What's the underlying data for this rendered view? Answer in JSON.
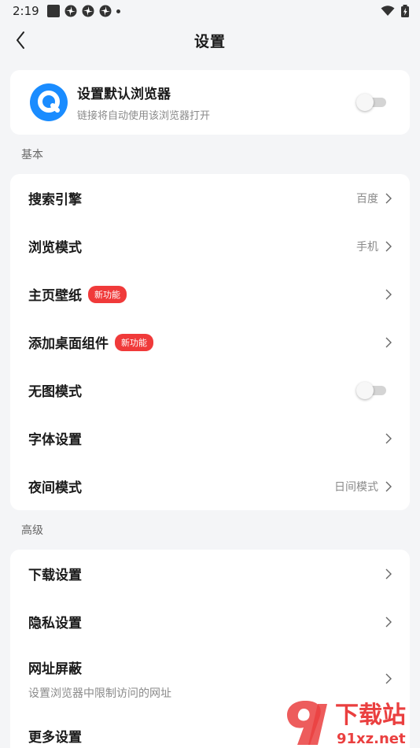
{
  "status": {
    "time": "2:19"
  },
  "header": {
    "title": "设置"
  },
  "default_browser": {
    "title": "设置默认浏览器",
    "subtitle": "链接将自动使用该浏览器打开",
    "enabled": false
  },
  "sections": {
    "basic": {
      "label": "基本",
      "items": [
        {
          "label": "搜索引擎",
          "value": "百度"
        },
        {
          "label": "浏览模式",
          "value": "手机"
        },
        {
          "label": "主页壁纸",
          "badge": "新功能"
        },
        {
          "label": "添加桌面组件",
          "badge": "新功能"
        },
        {
          "label": "无图模式",
          "toggle": false
        },
        {
          "label": "字体设置"
        },
        {
          "label": "夜间模式",
          "value": "日间模式"
        }
      ]
    },
    "advanced": {
      "label": "高级",
      "items": [
        {
          "label": "下载设置"
        },
        {
          "label": "隐私设置"
        },
        {
          "label": "网址屏蔽",
          "subtitle": "设置浏览器中限制访问的网址"
        },
        {
          "label": "更多设置"
        }
      ]
    }
  },
  "watermark": {
    "text": "下载站",
    "domain": "91xz.net"
  },
  "colors": {
    "accent": "#1a8cff",
    "badge": "#f03a3a",
    "background": "#f4f5f7"
  }
}
